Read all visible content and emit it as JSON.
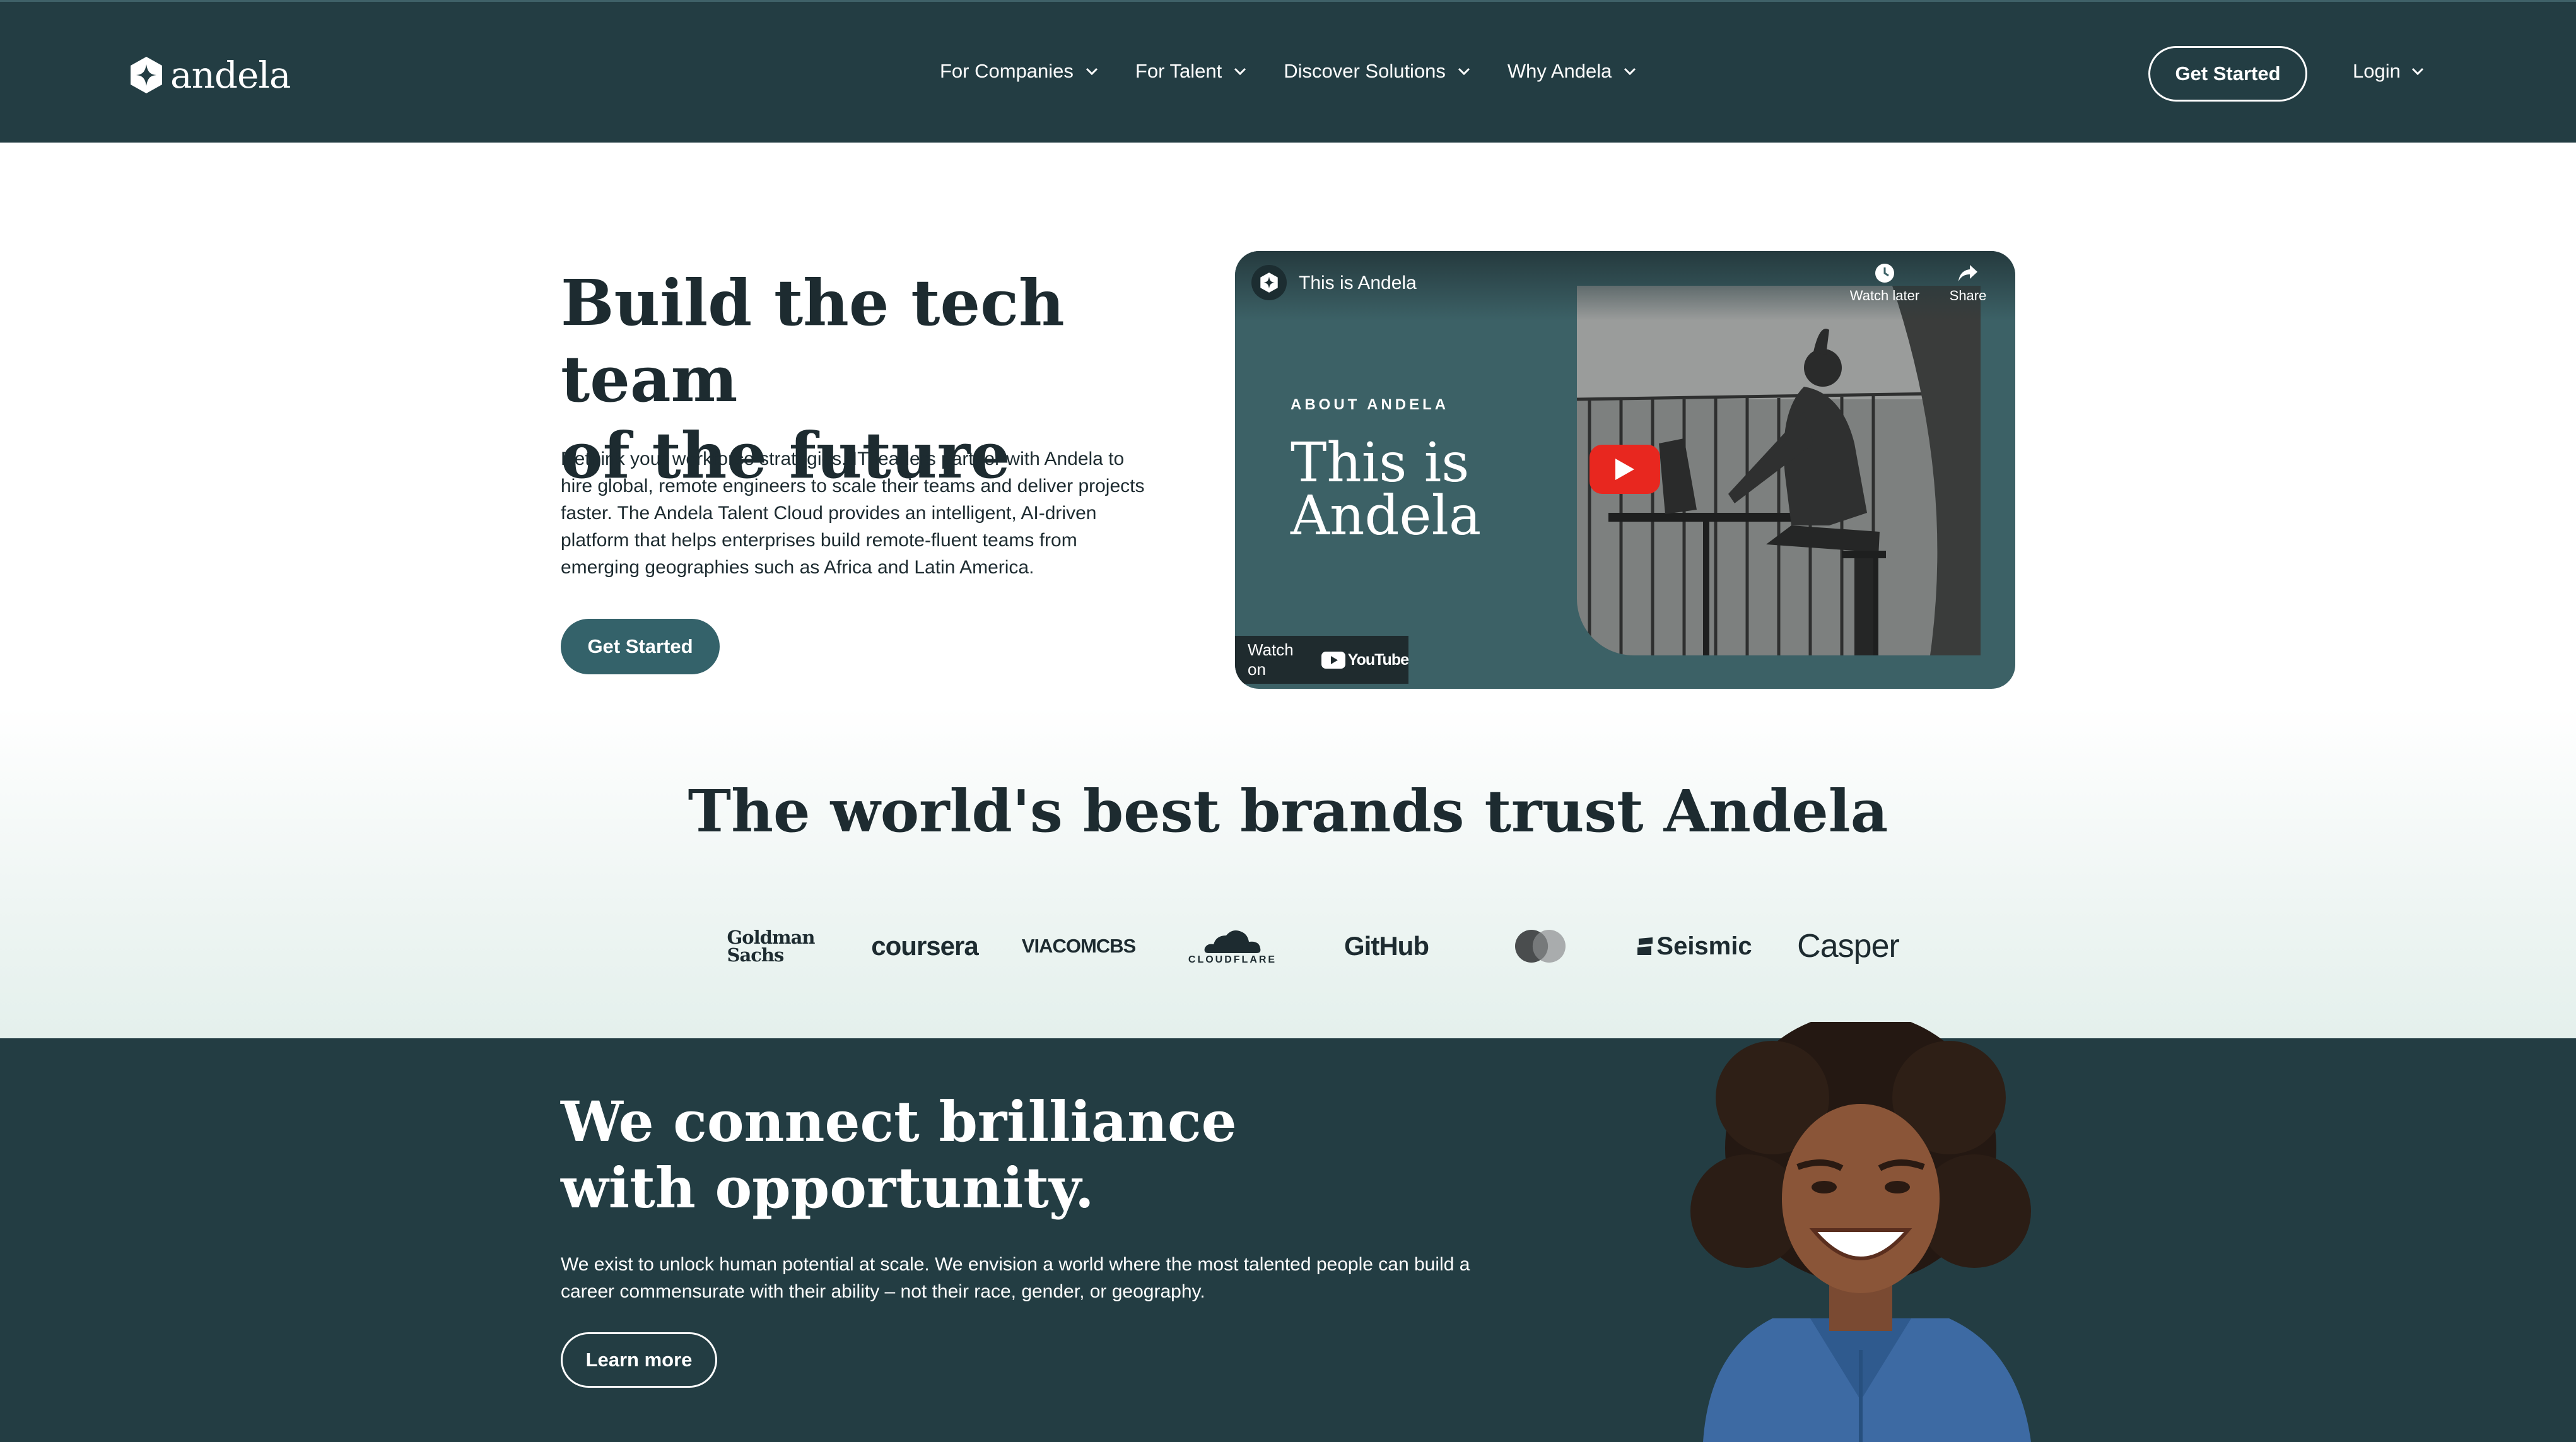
{
  "header": {
    "brand": "andela",
    "nav": [
      {
        "label": "For Companies"
      },
      {
        "label": "For Talent"
      },
      {
        "label": "Discover Solutions"
      },
      {
        "label": "Why Andela"
      }
    ],
    "cta_label": "Get Started",
    "login_label": "Login"
  },
  "hero": {
    "title_line1": "Build the tech team",
    "title_line2": "of the future",
    "description": "Rethink your workforce strategies. IT leaders partner with Andela to hire global, remote engineers to scale their teams and deliver projects faster. The Andela Talent Cloud provides an intelligent, AI-driven platform that helps enterprises build remote-fluent teams from emerging geographies such as Africa and Latin America.",
    "cta_label": "Get Started"
  },
  "video": {
    "title": "This is Andela",
    "watch_later": "Watch later",
    "share": "Share",
    "eyebrow": "ABOUT ANDELA",
    "headline_line1": "This is",
    "headline_line2": "Andela",
    "watch_on": "Watch on",
    "youtube": "YouTube"
  },
  "brands": {
    "title": "The world's best brands trust Andela",
    "logos": [
      {
        "line1": "Goldman",
        "line2": "Sachs"
      },
      {
        "name": "coursera"
      },
      {
        "name": "VIACOMCBS"
      },
      {
        "name": "CLOUDFLARE"
      },
      {
        "name": "GitHub"
      },
      {
        "name": "mastercard-logo"
      },
      {
        "name": "Seismic"
      },
      {
        "name": "Casper"
      }
    ]
  },
  "mission": {
    "title_line1": "We connect brilliance",
    "title_line2": "with opportunity.",
    "description": "We exist to unlock human potential at scale. We envision a world where the most talented people can build a career commensurate with their ability – not their race, gender, or geography.",
    "cta_label": "Learn more"
  },
  "colors": {
    "nav_bg": "#233d43",
    "primary_button": "#34626a",
    "video_bg": "#3c6166",
    "youtube_red": "#e8271f"
  }
}
